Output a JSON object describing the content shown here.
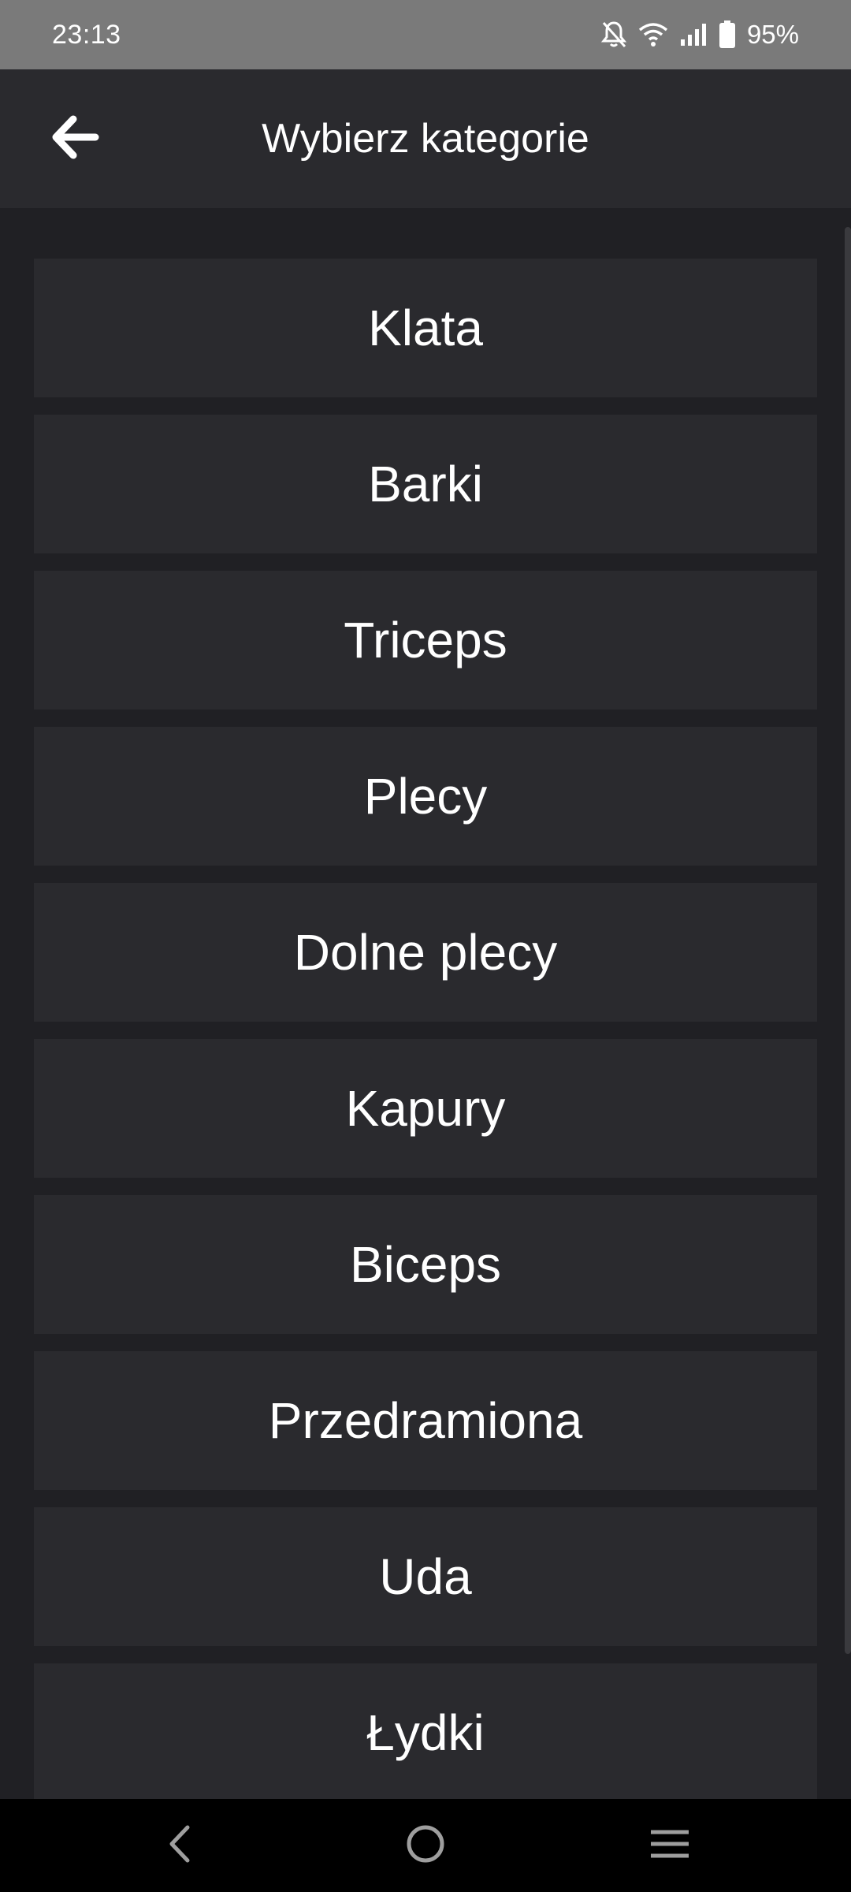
{
  "status_bar": {
    "time": "23:13",
    "battery": "95%",
    "icons": [
      "notifications-off-icon",
      "wifi-icon",
      "signal-icon",
      "battery-icon"
    ]
  },
  "app_bar": {
    "title": "Wybierz kategorie",
    "back_icon": "arrow-back-icon"
  },
  "categories": [
    "Klata",
    "Barki",
    "Triceps",
    "Plecy",
    "Dolne plecy",
    "Kapury",
    "Biceps",
    "Przedramiona",
    "Uda",
    "Łydki"
  ],
  "nav_bar": {
    "icons": [
      "nav-back-icon",
      "nav-home-icon",
      "nav-recents-icon"
    ]
  },
  "colors": {
    "background": "#202024",
    "surface": "#2a2a2e",
    "status_bar": "#7a7a7a",
    "text": "#ffffff"
  }
}
